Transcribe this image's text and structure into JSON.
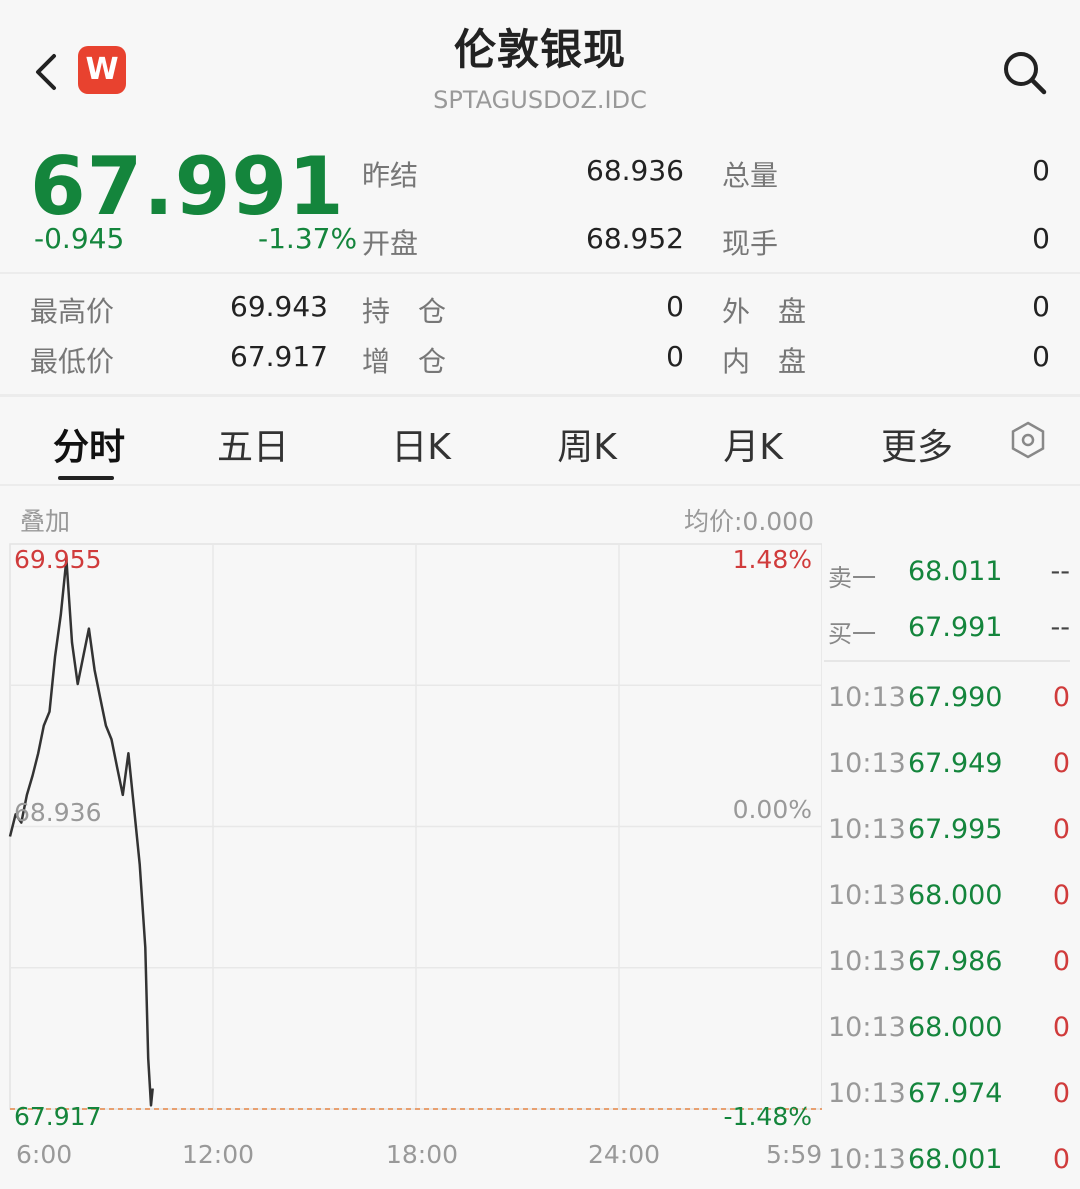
{
  "header": {
    "title": "伦敦银现",
    "code": "SPTAGUSDOZ.IDC",
    "badge": "W"
  },
  "quote": {
    "price": "67.991",
    "change": "-0.945",
    "change_pct": "-1.37%",
    "fields": [
      {
        "label": "昨结",
        "value": "68.936"
      },
      {
        "label": "开盘",
        "value": "68.952"
      },
      {
        "label": "总量",
        "value": "0"
      },
      {
        "label": "现手",
        "value": "0"
      },
      {
        "label": "最高价",
        "value": "69.943"
      },
      {
        "label": "最低价",
        "value": "67.917"
      },
      {
        "label": "持　仓",
        "value": "0"
      },
      {
        "label": "增　仓",
        "value": "0"
      },
      {
        "label": "外　盘",
        "value": "0"
      },
      {
        "label": "内　盘",
        "value": "0"
      }
    ]
  },
  "tabs": [
    {
      "label": "分时",
      "active": true
    },
    {
      "label": "五日"
    },
    {
      "label": "日K"
    },
    {
      "label": "周K"
    },
    {
      "label": "月K"
    },
    {
      "label": "更多"
    }
  ],
  "chart_panel": {
    "overlay_label": "叠加",
    "avg_price_label": "均价:0.000",
    "high_label": "69.955",
    "high_pct": "1.48%",
    "ref_label": "68.936",
    "ref_pct": "0.00%",
    "low_label": "67.917",
    "low_pct": "-1.48%",
    "x_ticks": [
      "6:00",
      "12:00",
      "18:00",
      "24:00",
      "5:59"
    ]
  },
  "colors": {
    "up": "#d03b3b",
    "down": "#14853c",
    "line": "#333333",
    "low_line": "#e8a070"
  },
  "chart_data": {
    "type": "line",
    "title": "",
    "xlabel": "",
    "ylabel": "",
    "x_range": [
      "6:00",
      "5:59"
    ],
    "ylim": [
      67.917,
      69.955
    ],
    "reference": 68.936,
    "series": [
      {
        "x": [
          "6:00",
          "6:10",
          "6:20",
          "6:30",
          "6:40",
          "6:50",
          "7:00",
          "7:10",
          "7:20",
          "7:30",
          "7:40",
          "7:50",
          "8:00",
          "8:10",
          "8:20",
          "8:30",
          "8:40",
          "8:50",
          "9:00",
          "9:10",
          "9:20",
          "9:30",
          "9:40",
          "9:50",
          "10:00",
          "10:05",
          "10:10",
          "10:13"
        ],
        "values": [
          68.9,
          68.98,
          68.95,
          69.05,
          69.12,
          69.2,
          69.3,
          69.35,
          69.55,
          69.7,
          69.9,
          69.6,
          69.45,
          69.55,
          69.65,
          69.5,
          69.4,
          69.3,
          69.25,
          69.15,
          69.05,
          69.2,
          69.0,
          68.8,
          68.5,
          68.1,
          67.93,
          67.991
        ]
      }
    ]
  },
  "order_book": {
    "asks": [
      {
        "label": "卖一",
        "price": "68.011",
        "vol": "--"
      }
    ],
    "bids": [
      {
        "label": "买一",
        "price": "67.991",
        "vol": "--"
      }
    ],
    "ticks": [
      {
        "time": "10:13",
        "price": "67.990",
        "vol": "0"
      },
      {
        "time": "10:13",
        "price": "67.949",
        "vol": "0"
      },
      {
        "time": "10:13",
        "price": "67.995",
        "vol": "0"
      },
      {
        "time": "10:13",
        "price": "68.000",
        "vol": "0"
      },
      {
        "time": "10:13",
        "price": "67.986",
        "vol": "0"
      },
      {
        "time": "10:13",
        "price": "68.000",
        "vol": "0"
      },
      {
        "time": "10:13",
        "price": "67.974",
        "vol": "0"
      },
      {
        "time": "10:13",
        "price": "68.001",
        "vol": "0"
      }
    ]
  }
}
